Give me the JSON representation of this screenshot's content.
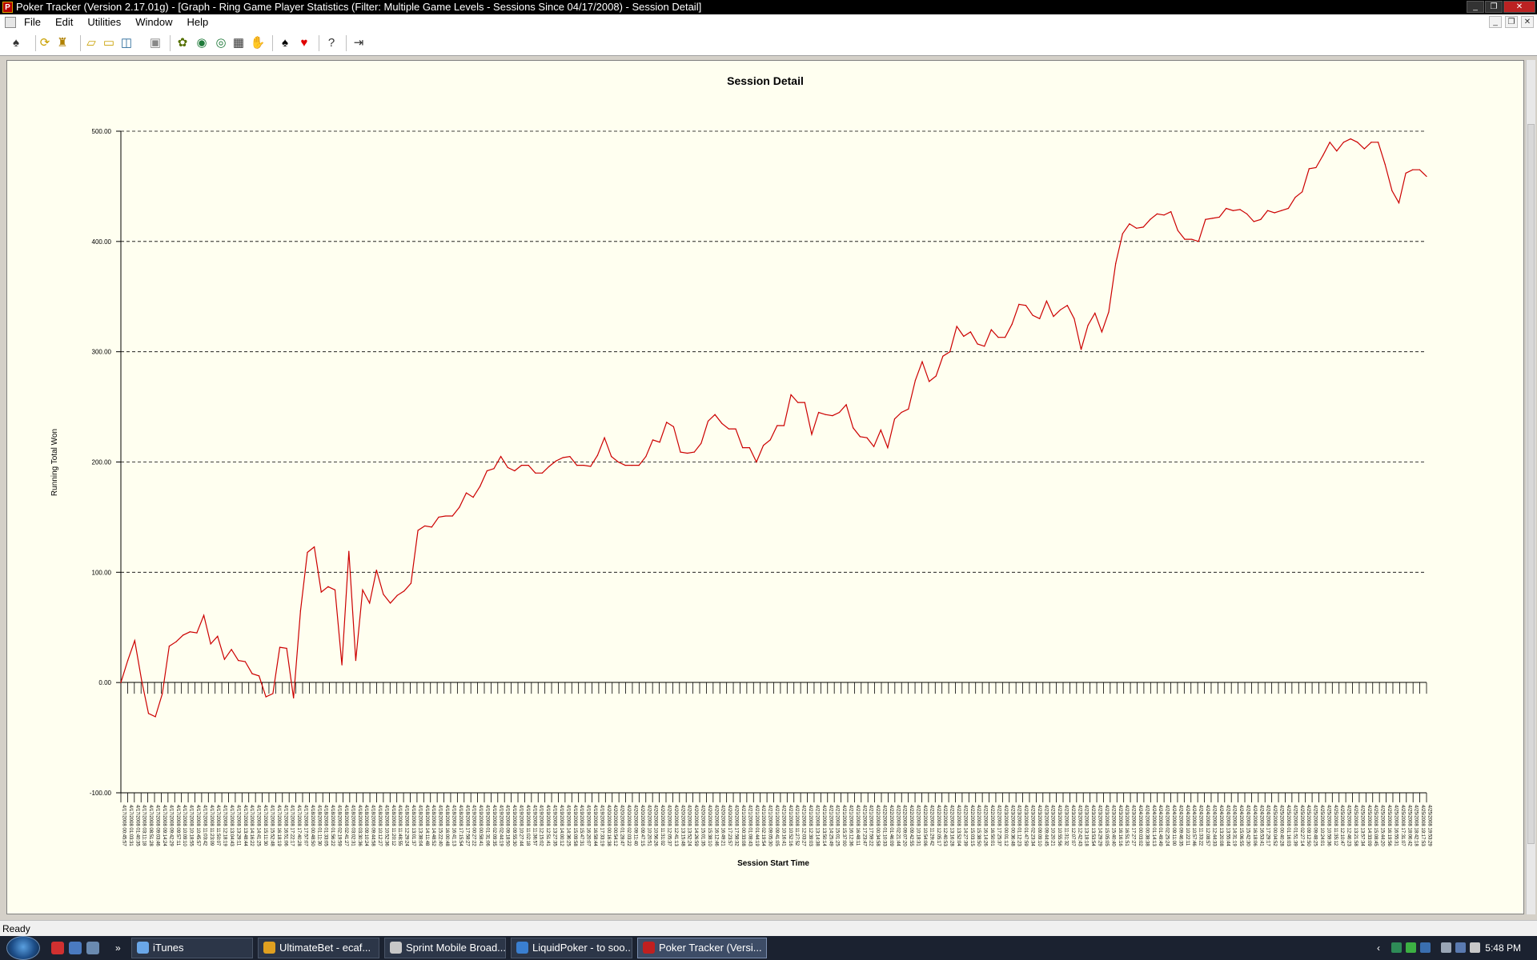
{
  "window": {
    "title": "Poker Tracker (Version 2.17.01g) - [Graph - Ring Game Player Statistics (Filter: Multiple Game Levels - Sessions Since 04/17/2008) - Session Detail]",
    "icon": "poker-tracker-app-icon",
    "controls": [
      "minimize",
      "restore",
      "close"
    ]
  },
  "menu": {
    "items": [
      "File",
      "Edit",
      "Utilities",
      "Window",
      "Help"
    ]
  },
  "toolbar": {
    "buttons": [
      "player-swap-icon",
      "refresh-icon",
      "trophy-icon",
      "open-folder-icon",
      "folder-icon",
      "database-icon",
      "save-icon",
      "import-icon",
      "update-icon",
      "auto-import-icon",
      "grid-icon",
      "hand-icon",
      "spade-icon",
      "heart-icon",
      "help-icon",
      "exit-icon"
    ]
  },
  "chart_data": {
    "type": "line",
    "title": "Session Detail",
    "xlabel": "Session Start Time",
    "ylabel": "Running Total Won",
    "ylim": [
      -100,
      500
    ],
    "yticks": [
      "500.00",
      "400.00",
      "300.00",
      "200.00",
      "100.00",
      "0.00",
      "-100.00"
    ],
    "ytick_values": [
      500,
      400,
      300,
      200,
      100,
      0,
      -100
    ],
    "grid": "horizontal dashed",
    "line_color": "#cc0000",
    "values": [
      0,
      20,
      38,
      2,
      -28,
      -31,
      -10,
      33,
      37,
      43,
      46,
      45,
      61,
      35,
      42,
      21,
      30,
      20,
      19,
      8,
      6,
      -13,
      -10,
      32,
      31,
      -14,
      65,
      118,
      123,
      82,
      87,
      84,
      16,
      119,
      20,
      84,
      72,
      102,
      80,
      72,
      79,
      83,
      90,
      138,
      142,
      141,
      150,
      151,
      151,
      159,
      172,
      168,
      178,
      192,
      194,
      205,
      195,
      192,
      197,
      197,
      190,
      190,
      196,
      201,
      204,
      205,
      197,
      197,
      196,
      206,
      222,
      205,
      200,
      197,
      197,
      197,
      205,
      220,
      218,
      236,
      232,
      209,
      208,
      209,
      217,
      237,
      243,
      235,
      230,
      230,
      213,
      213,
      200,
      215,
      220,
      233,
      233,
      261,
      254,
      254,
      225,
      245,
      243,
      242,
      245,
      252,
      231,
      223,
      222,
      214,
      229,
      213,
      239,
      245,
      248,
      274,
      291,
      273,
      278,
      296,
      300,
      323,
      314,
      318,
      307,
      305,
      320,
      313,
      313,
      325,
      343,
      342,
      333,
      330,
      346,
      332,
      338,
      342,
      330,
      302,
      324,
      335,
      318,
      336,
      380,
      407,
      416,
      412,
      413,
      420,
      425,
      424,
      427,
      410,
      402,
      402,
      400,
      420,
      421,
      422,
      430,
      428,
      429,
      425,
      418,
      420,
      428,
      426,
      428,
      430,
      440,
      445,
      466,
      467,
      478,
      490,
      482,
      490,
      493,
      490,
      484,
      490,
      490,
      470,
      446,
      435,
      462,
      465,
      465,
      459
    ],
    "x_tick_labels": [
      "4/17/2008 00:45:57",
      "4/17/2008 01:03:31",
      "4/17/2008 01:40:35",
      "4/17/2008 03:11:18",
      "4/17/2008 08:51:28",
      "4/17/2008 09:03:46",
      "4/17/2008 09:14:24",
      "4/17/2008 09:42:29",
      "4/17/2008 09:57:11",
      "4/17/2008 10:09:10",
      "4/17/2008 10:18:55",
      "4/17/2008 10:45:57",
      "4/17/2008 11:03:42",
      "4/17/2008 11:23:09",
      "4/17/2008 11:50:07",
      "4/17/2008 12:18:19",
      "4/17/2008 13:04:43",
      "4/17/2008 13:29:11",
      "4/17/2008 13:48:44",
      "4/17/2008 14:16:22",
      "4/17/2008 14:41:25",
      "4/17/2008 15:11:30",
      "4/17/2008 15:52:48",
      "4/17/2008 16:18:19",
      "4/17/2008 16:51:06",
      "4/17/2008 17:22:17",
      "4/17/2008 17:40:28",
      "4/17/2008 17:57:07",
      "4/18/2008 00:48:50",
      "4/18/2008 01:11:30",
      "4/18/2008 01:33:05",
      "4/18/2008 01:56:22",
      "4/18/2008 02:19:59",
      "4/18/2008 02:41:27",
      "4/18/2008 03:02:31",
      "4/18/2008 03:30:36",
      "4/18/2008 09:10:24",
      "4/18/2008 09:44:58",
      "4/18/2008 10:12:27",
      "4/18/2008 10:52:36",
      "4/18/2008 11:20:12",
      "4/18/2008 11:48:55",
      "4/18/2008 12:29:24",
      "4/18/2008 13:01:37",
      "4/18/2008 13:38:04",
      "4/18/2008 14:11:48",
      "4/18/2008 14:48:52",
      "4/18/2008 15:22:40",
      "4/18/2008 16:00:48",
      "4/18/2008 16:41:13",
      "4/18/2008 17:15:54",
      "4/18/2008 17:58:27",
      "4/19/2008 00:27:22",
      "4/19/2008 00:58:41",
      "4/19/2008 01:31:06",
      "4/19/2008 02:09:35",
      "4/19/2008 02:44:19",
      "4/19/2008 09:18:50",
      "4/19/2008 09:55:30",
      "4/19/2008 10:27:44",
      "4/19/2008 11:02:18",
      "4/19/2008 11:36:57",
      "4/19/2008 12:15:02",
      "4/19/2008 12:51:41",
      "4/19/2008 13:27:35",
      "4/19/2008 14:00:12",
      "4/19/2008 14:36:25",
      "4/19/2008 15:09:58",
      "4/19/2008 15:47:31",
      "4/19/2008 16:20:07",
      "4/19/2008 16:58:44",
      "4/19/2008 17:33:19",
      "4/20/2008 00:16:38",
      "4/20/2008 00:54:12",
      "4/20/2008 01:28:47",
      "4/20/2008 02:03:22",
      "4/20/2008 09:11:40",
      "4/20/2008 09:47:15",
      "4/20/2008 10:20:51",
      "4/20/2008 10:56:26",
      "4/20/2008 11:31:02",
      "4/20/2008 12:05:37",
      "4/20/2008 12:41:13",
      "4/20/2008 13:15:48",
      "4/20/2008 13:52:24",
      "4/20/2008 14:26:59",
      "4/20/2008 15:01:35",
      "4/20/2008 15:38:10",
      "4/20/2008 16:12:46",
      "4/20/2008 16:49:21",
      "4/20/2008 17:23:57",
      "4/20/2008 17:58:32",
      "4/21/2008 00:33:08",
      "4/21/2008 01:08:43",
      "4/21/2008 01:44:19",
      "4/21/2008 02:19:54",
      "4/21/2008 09:05:30",
      "4/21/2008 09:41:05",
      "4/21/2008 10:16:41",
      "4/21/2008 10:52:16",
      "4/21/2008 11:27:52",
      "4/21/2008 12:03:27",
      "4/21/2008 12:39:03",
      "4/21/2008 13:14:38",
      "4/21/2008 13:50:14",
      "4/21/2008 14:25:49",
      "4/21/2008 15:01:25",
      "4/21/2008 15:37:00",
      "4/21/2008 16:12:36",
      "4/21/2008 16:48:11",
      "4/21/2008 17:23:47",
      "4/21/2008 17:59:22",
      "4/22/2008 00:34:58",
      "4/22/2008 01:10:33",
      "4/22/2008 01:46:09",
      "4/22/2008 02:21:44",
      "4/22/2008 09:07:20",
      "4/22/2008 09:42:55",
      "4/22/2008 10:18:31",
      "4/22/2008 10:54:06",
      "4/22/2008 11:29:42",
      "4/22/2008 12:05:17",
      "4/22/2008 12:40:53",
      "4/22/2008 13:16:28",
      "4/22/2008 13:52:04",
      "4/22/2008 14:27:39",
      "4/22/2008 15:03:15",
      "4/22/2008 15:38:50",
      "4/22/2008 16:14:26",
      "4/22/2008 16:50:01",
      "4/22/2008 17:25:37",
      "4/23/2008 00:01:12",
      "4/23/2008 00:36:48",
      "4/23/2008 01:12:23",
      "4/23/2008 01:47:59",
      "4/23/2008 02:23:34",
      "4/23/2008 09:09:10",
      "4/23/2008 09:44:45",
      "4/23/2008 10:20:21",
      "4/23/2008 10:55:56",
      "4/23/2008 11:31:32",
      "4/23/2008 12:07:07",
      "4/23/2008 12:42:43",
      "4/23/2008 13:18:18",
      "4/23/2008 13:53:54",
      "4/23/2008 14:29:29",
      "4/23/2008 15:05:05",
      "4/23/2008 15:40:40",
      "4/23/2008 16:16:16",
      "4/23/2008 16:51:51",
      "4/23/2008 17:27:27",
      "4/24/2008 00:03:02",
      "4/24/2008 00:38:38",
      "4/24/2008 01:14:13",
      "4/24/2008 01:49:49",
      "4/24/2008 02:25:24",
      "4/24/2008 09:11:00",
      "4/24/2008 09:46:35",
      "4/24/2008 10:22:11",
      "4/24/2008 10:57:46",
      "4/24/2008 11:33:22",
      "4/24/2008 12:08:57",
      "4/24/2008 12:44:33",
      "4/24/2008 13:20:08",
      "4/24/2008 13:55:44",
      "4/24/2008 14:31:19",
      "4/24/2008 15:06:55",
      "4/24/2008 15:42:30",
      "4/24/2008 16:18:06",
      "4/24/2008 16:53:41",
      "4/24/2008 17:29:17",
      "4/25/2008 00:04:52",
      "4/25/2008 00:40:28",
      "4/25/2008 01:16:03",
      "4/25/2008 01:51:39",
      "4/25/2008 02:27:14",
      "4/25/2008 09:12:50",
      "4/25/2008 09:48:25",
      "4/25/2008 10:24:01",
      "4/25/2008 10:59:36",
      "4/25/2008 11:35:12",
      "4/25/2008 12:10:47",
      "4/25/2008 12:46:23",
      "4/25/2008 13:21:58",
      "4/25/2008 13:57:34",
      "4/25/2008 14:33:09",
      "4/25/2008 15:08:45",
      "4/25/2008 15:44:20",
      "4/25/2008 16:19:56",
      "4/25/2008 16:55:31",
      "4/25/2008 17:31:07",
      "4/25/2008 18:06:42",
      "4/25/2008 18:42:18",
      "4/25/2008 19:17:53",
      "4/25/2008 19:53:29"
    ]
  },
  "status": {
    "text": "Ready"
  },
  "taskbar": {
    "buttons": [
      {
        "label": "iTunes",
        "icon": "itunes-icon",
        "color": "#6aa7e8"
      },
      {
        "label": "UltimateBet  -  ecaf...",
        "icon": "ultimatebet-icon",
        "color": "#e0a020"
      },
      {
        "label": "Sprint Mobile Broad...",
        "icon": "sprint-icon",
        "color": "#c8c8c8"
      },
      {
        "label": "LiquidPoker - to soo...",
        "icon": "ie-icon",
        "color": "#3a7fd0"
      },
      {
        "label": "Poker Tracker (Versi...",
        "icon": "poker-tracker-icon",
        "color": "#c02020",
        "active": true
      }
    ],
    "clock": "5:48 PM"
  }
}
